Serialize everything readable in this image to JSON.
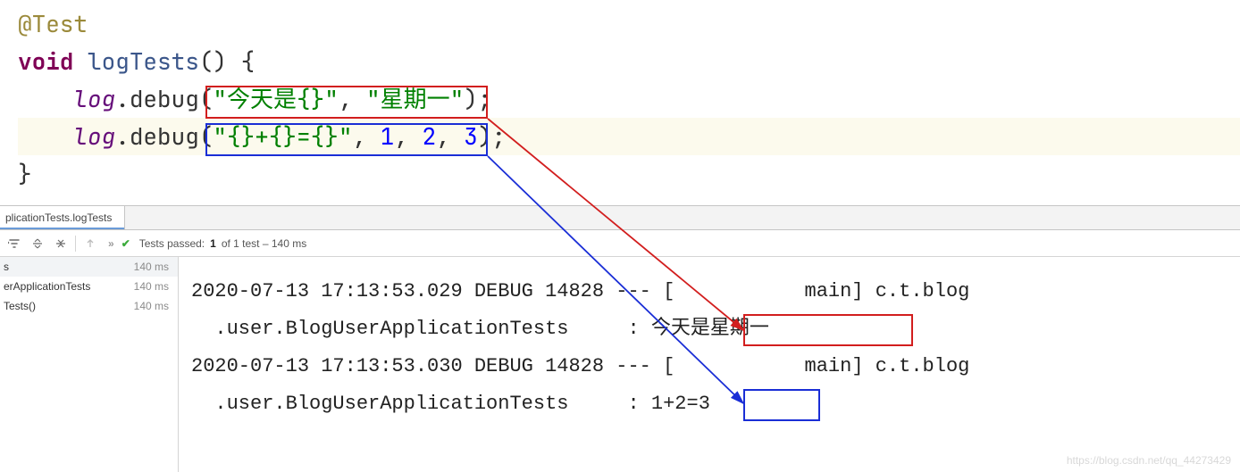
{
  "code": {
    "annotation": "@Test",
    "keyword_void": "void",
    "method_name": "logTests",
    "paren_open": "() {",
    "log_ident": "log",
    "call_debug": ".debug(",
    "line1_str1": "\"今天是{}\"",
    "line1_comma": ", ",
    "line1_str2": "\"星期一\"",
    "line1_close": ");",
    "line2_str": "\"{}+{}={}\"",
    "comma": ", ",
    "n1": "1",
    "n2": "2",
    "n3": "3",
    "line2_close": ");",
    "brace_close": "}"
  },
  "panel": {
    "tab_label": "plicationTests.logTests"
  },
  "toolbar": {
    "status_pre": "Tests passed:",
    "status_count": " 1 ",
    "status_tail": "of 1 test – 140 ms"
  },
  "tree": {
    "row0_label": "s",
    "row0_ms": "140 ms",
    "row1_label": "erApplicationTests",
    "row1_ms": "140 ms",
    "row2_label": "Tests()",
    "row2_ms": "140 ms"
  },
  "console": {
    "line1": "2020-07-13 17:13:53.029 DEBUG 14828 --- [           main] c.t.blog",
    "line2a": "  .user.BlogUserApplicationTests     : ",
    "line2b": "今天是星期一",
    "line3": "2020-07-13 17:13:53.030 DEBUG 14828 --- [           main] c.t.blog",
    "line4a": "  .user.BlogUserApplicationTests     : ",
    "line4b": "1+2=3"
  },
  "watermark": "https://blog.csdn.net/qq_44273429"
}
